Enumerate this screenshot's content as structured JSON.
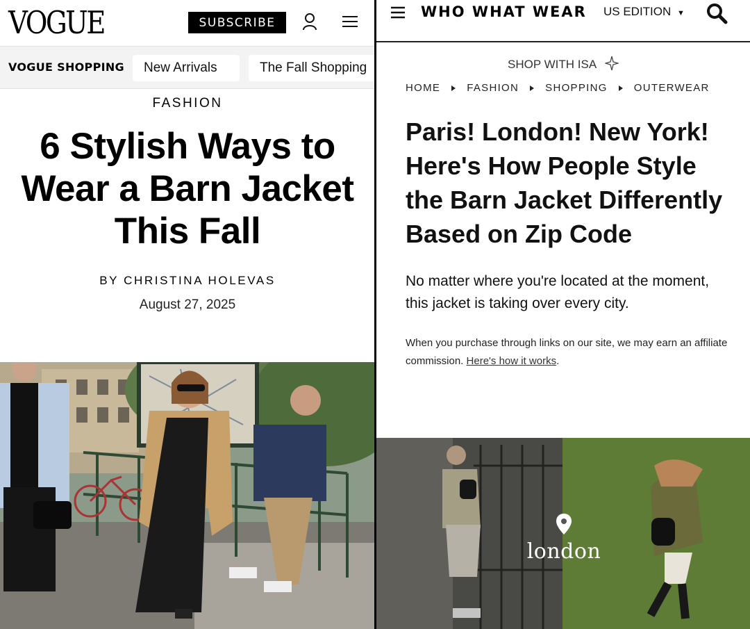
{
  "vogue": {
    "logo": "VOGUE",
    "subscribe_label": "SUBSCRIBE",
    "account_icon": "account-icon",
    "menu_icon": "hamburger-menu-icon",
    "shopping_label": "VOGUE SHOPPING",
    "shopping_chips": [
      "New Arrivals",
      "The Fall Shopping"
    ],
    "kicker": "FASHION",
    "title": "6 Stylish Ways to Wear a Barn Jacket This Fall",
    "byline": "BY CHRISTINA HOLEVAS",
    "date": "August 27, 2025"
  },
  "whowhatwear": {
    "menu_icon": "hamburger-menu-icon",
    "logo": "WHO WHAT WEAR",
    "edition": "US EDITION",
    "search_icon": "search-icon",
    "shop_label": "SHOP WITH ISA",
    "breadcrumbs": [
      "HOME",
      "FASHION",
      "SHOPPING",
      "OUTERWEAR"
    ],
    "title": "Paris! London! New York! Here's How People Style the Barn Jacket Differently Based on Zip Code",
    "dek": "No matter where you're located at the moment, this jacket is taking over every city.",
    "disclaimer_text": "When you purchase through links on our site, we may earn an affiliate commission.",
    "disclaimer_link": "Here's how it works",
    "location_label": "london"
  },
  "colors": {
    "black": "#000000",
    "shop_bar_bg": "#f3f3f3",
    "text": "#111111"
  }
}
